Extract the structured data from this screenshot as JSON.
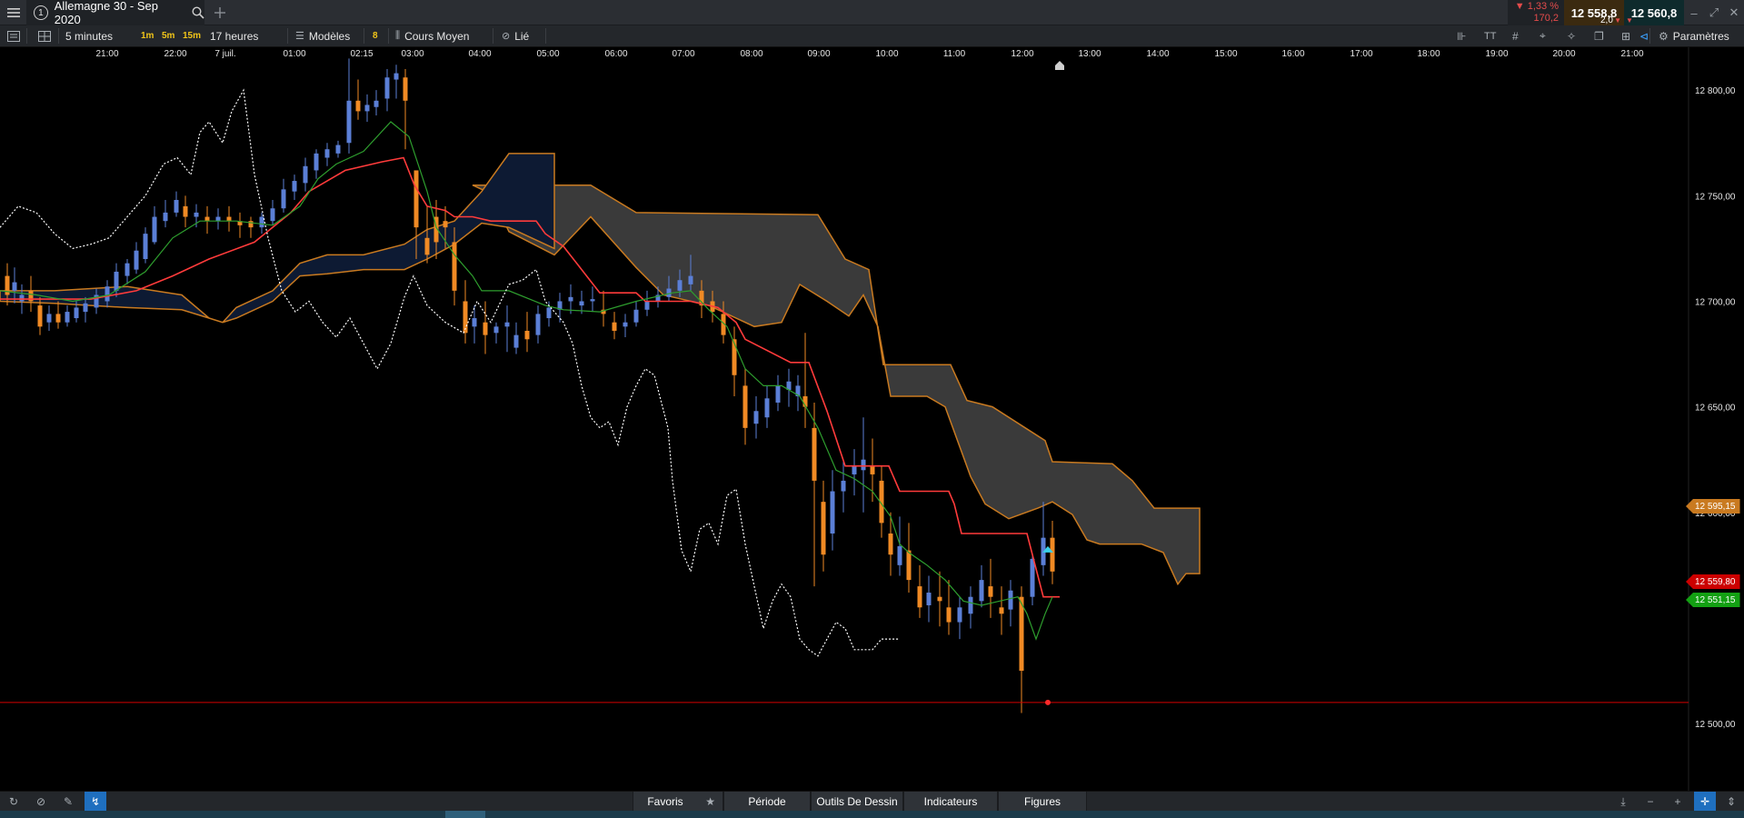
{
  "window": {
    "tab_number": "1",
    "tab_title": "Allemagne 30 - Sep 2020",
    "add_tab_icon": "plus-icon"
  },
  "quote": {
    "change_pct": "▼ 1,33 %",
    "change_pts": "170,2",
    "sell_price": "12 558,8",
    "buy_price": "12 560,8",
    "spread": "2,0",
    "down_color": "#e34b4b"
  },
  "toolbar": {
    "interval": "5 minutes",
    "quick_1m": "1m",
    "quick_5m": "5m",
    "quick_15m": "15m",
    "period": "17 heures",
    "templates": "Modèles",
    "templates_count": "8",
    "chart_type": "Cours Moyen",
    "link": "Lié",
    "settings": "Paramètres"
  },
  "chart_data": {
    "type": "candlestick",
    "x_tick_labels": [
      "21:00",
      "22:00",
      "7 juil.",
      "01:00",
      "02:15",
      "03:00",
      "04:00",
      "05:00",
      "06:00",
      "07:00",
      "08:00",
      "09:00",
      "10:00",
      "11:00",
      "12:00",
      "13:00",
      "14:00",
      "15:00",
      "16:00",
      "17:00",
      "18:00",
      "19:00",
      "20:00",
      "21:00"
    ],
    "y_tick_labels": [
      "12 800,00",
      "12 750,00",
      "12 700,00",
      "12 650,00",
      "12 600,00",
      "12 500,00"
    ],
    "y_ticks": [
      12800,
      12750,
      12700,
      12650,
      12600,
      12500
    ],
    "ylim": [
      12494,
      12816
    ],
    "price_tags": {
      "cloud_edge": "12 595,15",
      "current": "12 559,80",
      "tenkan": "12 551,15"
    },
    "horizontal_line": 12510,
    "colors": {
      "up_candle": "#5b7fd6",
      "down_candle": "#f08a24",
      "kijun": "#ff3b3b",
      "tenkan": "#2e9e2e",
      "chikou": "#ffffff",
      "cloud_bear": "#3a3a3a",
      "cloud_bull": "#0d1a33",
      "cloud_edge": "#c97a20"
    }
  },
  "bottom": {
    "favorites": "Favoris",
    "period": "Période",
    "drawing_tools": "Outils De Dessin",
    "indicators": "Indicateurs",
    "figures": "Figures"
  }
}
